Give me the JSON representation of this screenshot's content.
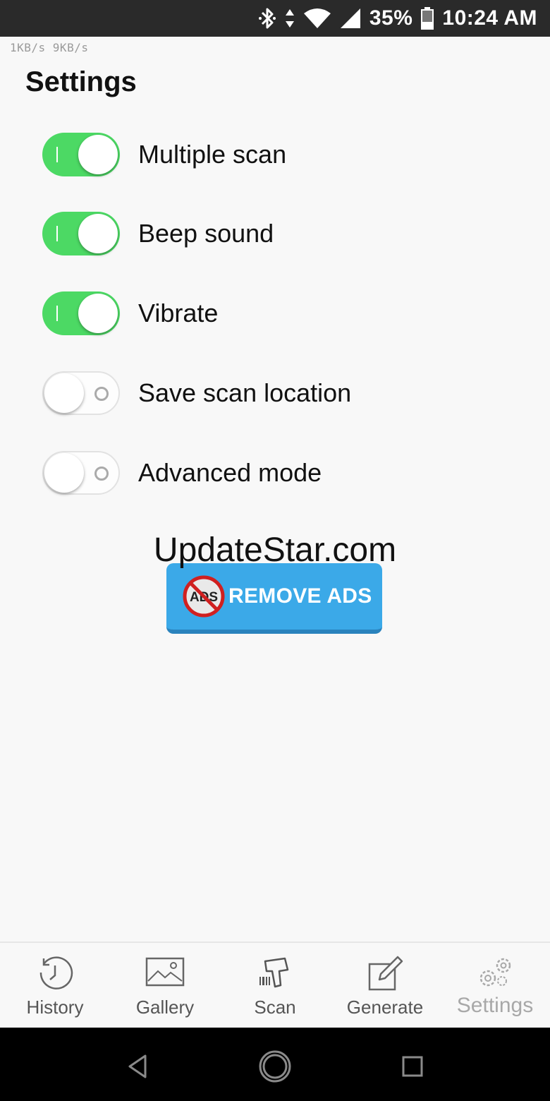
{
  "status_bar": {
    "battery": "35%",
    "time": "10:24 AM",
    "icons": [
      "bluetooth-icon",
      "data-arrows-icon",
      "wifi-icon",
      "cell-signal-icon",
      "battery-icon"
    ]
  },
  "network_speed": "1KB/s  9KB/s",
  "page_title": "Settings",
  "settings": [
    {
      "label": "Multiple scan",
      "on": true
    },
    {
      "label": "Beep sound",
      "on": true
    },
    {
      "label": "Vibrate",
      "on": true
    },
    {
      "label": "Save scan location",
      "on": false
    },
    {
      "label": "Advanced mode",
      "on": false
    }
  ],
  "watermark": "UpdateStar.com",
  "remove_ads": {
    "label": "REMOVE ADS",
    "icon_text": "ADS"
  },
  "bottom_nav": [
    {
      "label": "History",
      "icon": "clock-icon"
    },
    {
      "label": "Gallery",
      "icon": "image-icon"
    },
    {
      "label": "Scan",
      "icon": "barcode-scanner-icon"
    },
    {
      "label": "Generate",
      "icon": "edit-icon"
    },
    {
      "label": "Settings",
      "icon": "gear-icon",
      "active": true
    }
  ],
  "colors": {
    "toggle_on": "#4cd964",
    "remove_ads_bg": "#3ba9e8",
    "status_bar_bg": "#2a2a2a"
  }
}
